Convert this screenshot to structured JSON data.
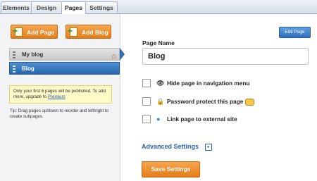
{
  "tabs": [
    "Elements",
    "Design",
    "Pages",
    "Settings"
  ],
  "active_tab": "Pages",
  "sidebar": {
    "add_page": "Add Page",
    "add_blog": "Add Blog",
    "pages": [
      {
        "label": "My blog"
      },
      {
        "label": "Blog"
      }
    ],
    "notice_text": "Only your first 6 pages will be published. To add more, upgrade to ",
    "notice_link": "Premium",
    "tip": "Tip: Drag pages up/down to reorder and left/right to create subpages."
  },
  "main": {
    "edit_page": "Edit Page",
    "page_name_label": "Page Name",
    "page_name_value": "Blog",
    "options": [
      {
        "label": "Hide page in navigation menu",
        "icon": "eye-icon"
      },
      {
        "label": "Password protect this page",
        "icon": "lock-icon"
      },
      {
        "label": "Link page to external site",
        "icon": "globe-icon"
      }
    ],
    "advanced_settings": "Advanced Settings",
    "save_settings": "Save Settings"
  },
  "colors": {
    "accent_orange": "#e57d18",
    "selected_blue": "#2f6cb2",
    "link_blue": "#2661b0",
    "notice_bg": "#fffbc6"
  }
}
